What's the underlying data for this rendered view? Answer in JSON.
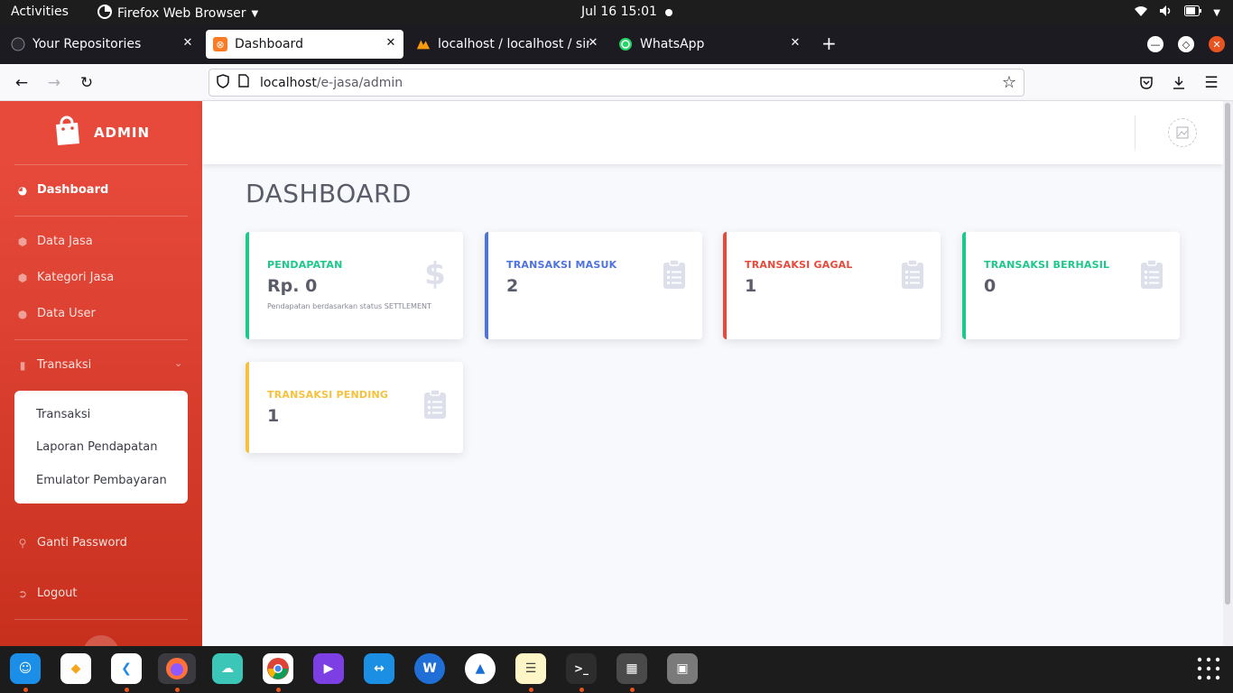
{
  "system": {
    "activities": "Activities",
    "app_menu": "Firefox Web Browser",
    "clock": "Jul 16  15:01"
  },
  "browser": {
    "tabs": [
      {
        "title": "Your Repositories",
        "active": false
      },
      {
        "title": "Dashboard",
        "active": true
      },
      {
        "title": "localhost / localhost / sim",
        "active": false
      },
      {
        "title": "WhatsApp",
        "active": false
      }
    ],
    "url_host": "localhost",
    "url_path": "/e-jasa/admin"
  },
  "sidebar": {
    "brand": "ADMIN",
    "items": {
      "dashboard": "Dashboard",
      "data_jasa": "Data Jasa",
      "kategori_jasa": "Kategori Jasa",
      "data_user": "Data User",
      "transaksi": "Transaksi",
      "ganti_password": "Ganti Password",
      "logout": "Logout"
    },
    "submenu": [
      "Transaksi",
      "Laporan Pendapatan",
      "Emulator Pembayaran"
    ]
  },
  "main": {
    "title": "DASHBOARD",
    "cards": [
      {
        "label": "PENDAPATAN",
        "value": "Rp. 0",
        "note": "Pendapatan berdasarkan status SETTLEMENT",
        "color": "#1cc88a",
        "icon": "dollar-icon"
      },
      {
        "label": "TRANSAKSI MASUK",
        "value": "2",
        "color": "#4e73df",
        "icon": "clipboard-list-icon"
      },
      {
        "label": "TRANSAKSI GAGAL",
        "value": "1",
        "color": "#e74a3b",
        "icon": "clipboard-list-icon"
      },
      {
        "label": "TRANSAKSI BERHASIL",
        "value": "0",
        "color": "#1cc88a",
        "icon": "clipboard-list-icon"
      },
      {
        "label": "TRANSAKSI PENDING",
        "value": "1",
        "color": "#f6c23e",
        "icon": "clipboard-list-icon"
      }
    ]
  },
  "colors": {
    "sidebar_top": "#e74a3b",
    "sidebar_bottom": "#c8301e",
    "text_dark": "#5a5c69",
    "icon_gray": "#dddfeb"
  }
}
